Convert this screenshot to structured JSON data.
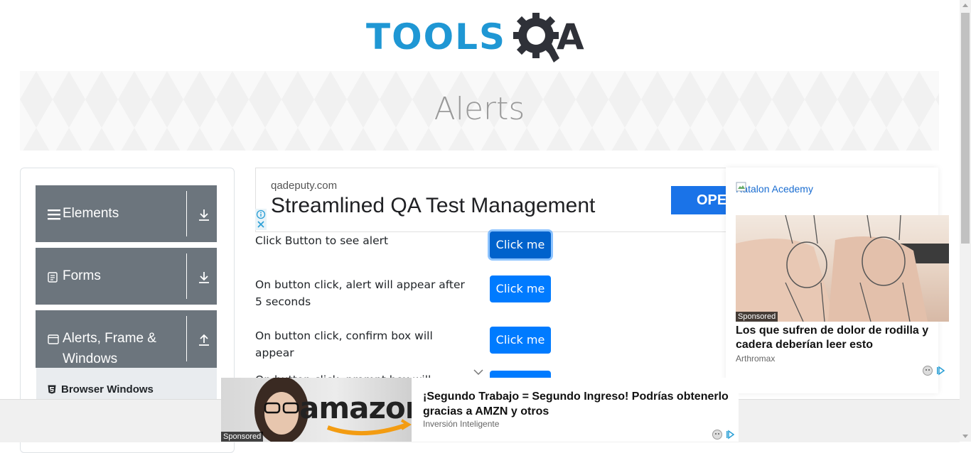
{
  "logo": {
    "left": "TOOLS",
    "right": "A"
  },
  "banner": {
    "title": "Alerts"
  },
  "sidebar": {
    "groups": [
      {
        "label": "Elements",
        "icon": "hamburger-icon"
      },
      {
        "label": "Forms",
        "icon": "document-icon"
      },
      {
        "label": "Alerts, Frame &",
        "label2": "Windows",
        "icon": "window-icon"
      }
    ],
    "submenu": {
      "item": "Browser Windows"
    }
  },
  "top_ad": {
    "domain": "qadeputy.com",
    "headline": "Streamlined QA Test Management",
    "cta": "OPE"
  },
  "rows": [
    {
      "text": "Click Button to see alert",
      "button": "Click me"
    },
    {
      "text": "On button click, alert will appear after 5 seconds",
      "button": "Click me"
    },
    {
      "text": "On button click, confirm box will appear",
      "button": "Click me"
    },
    {
      "text": "On button click, prompt box will appear",
      "button": "Click me"
    }
  ],
  "right_ad": {
    "brand": "Katalon Acedemy",
    "sponsored": "Sponsored",
    "title": "Los que sufren de dolor de rodilla y cadera deberían leer esto",
    "source": "Arthromax"
  },
  "bottom_ad": {
    "image_text": "amazon",
    "sponsored": "Sponsored",
    "title": "¡Segundo Trabajo = Segundo Ingreso! Podrías obtenerlo gracias a AMZN y otros",
    "source": "Inversión Inteligente"
  },
  "colors": {
    "primary": "#007bff",
    "sidebar": "#6c757d",
    "logo_blue": "#1f97d4",
    "logo_dark": "#2f3138"
  }
}
